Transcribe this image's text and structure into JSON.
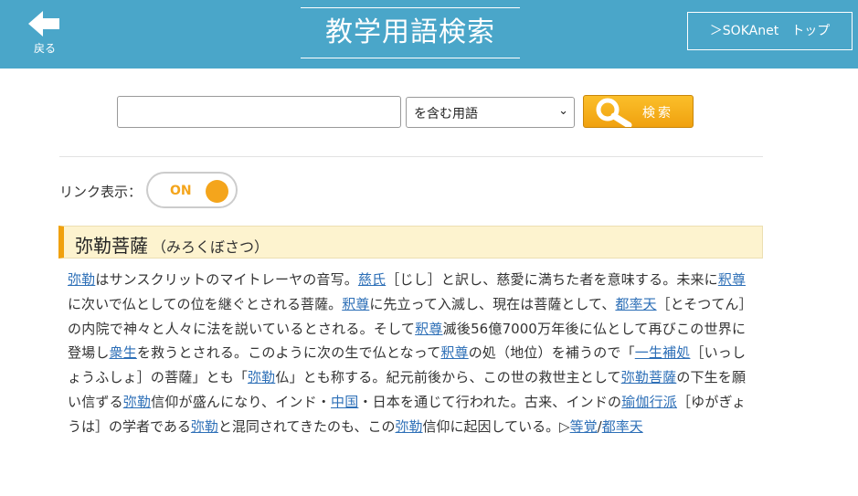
{
  "header": {
    "back_label": "戻る",
    "title": "教学用語検索",
    "top_button": "＞SOKAnet　トップ"
  },
  "search": {
    "value": "",
    "mode": "を含む用語",
    "button_label": "検索"
  },
  "link_toggle": {
    "label": "リンク表示：",
    "state": "ON"
  },
  "entry": {
    "term": "弥勒菩薩",
    "reading": "（みろくぼさつ）",
    "body": [
      {
        "t": "弥勒",
        "link": true
      },
      {
        "t": "はサンスクリットのマイトレーヤの音写。"
      },
      {
        "t": "慈氏",
        "link": true
      },
      {
        "t": "［じし］と訳し、慈愛に満ちた者を意味する。未来に"
      },
      {
        "t": "釈尊",
        "link": true
      },
      {
        "t": "に次いで仏としての位を継ぐとされる菩薩。"
      },
      {
        "t": "釈尊",
        "link": true
      },
      {
        "t": "に先立って入滅し、現在は菩薩として、"
      },
      {
        "t": "都率天",
        "link": true
      },
      {
        "t": "［とそつてん］の内院で神々と人々に法を説いているとされる。そして"
      },
      {
        "t": "釈尊",
        "link": true
      },
      {
        "t": "滅後56億7000万年後に仏として再びこの世界に登場し"
      },
      {
        "t": "衆生",
        "link": true
      },
      {
        "t": "を救うとされる。このように次の生で仏となって"
      },
      {
        "t": "釈尊",
        "link": true
      },
      {
        "t": "の処（地位）を補うので「"
      },
      {
        "t": "一生補処",
        "link": true
      },
      {
        "t": "［いっしょうふしょ］の菩薩」とも「"
      },
      {
        "t": "弥勒",
        "link": true
      },
      {
        "t": "仏」とも称する。紀元前後から、この世の救世主として"
      },
      {
        "t": "弥勒菩薩",
        "link": true
      },
      {
        "t": "の下生を願い信ずる"
      },
      {
        "t": "弥勒",
        "link": true
      },
      {
        "t": "信仰が盛んになり、インド・"
      },
      {
        "t": "中国",
        "link": true
      },
      {
        "t": "・日本を通じて行われた。古来、インドの"
      },
      {
        "t": "瑜伽行派",
        "link": true
      },
      {
        "t": "［ゆがぎょうは］の学者である"
      },
      {
        "t": "弥勒",
        "link": true
      },
      {
        "t": "と混同されてきたのも、この"
      },
      {
        "t": "弥勒",
        "link": true
      },
      {
        "t": "信仰に起因している。▷"
      },
      {
        "t": "等覚",
        "link": true
      },
      {
        "t": "/"
      },
      {
        "t": "都率天",
        "link": true
      }
    ]
  },
  "colors": {
    "header_bg": "#4aa6c9",
    "accent": "#f4a51c",
    "link": "#2d6fb7",
    "entry_bg": "#fdf3cf"
  },
  "icons": {
    "back": "arrow-left-icon",
    "search": "magnifier-icon",
    "select": "chevron-down-icon"
  }
}
